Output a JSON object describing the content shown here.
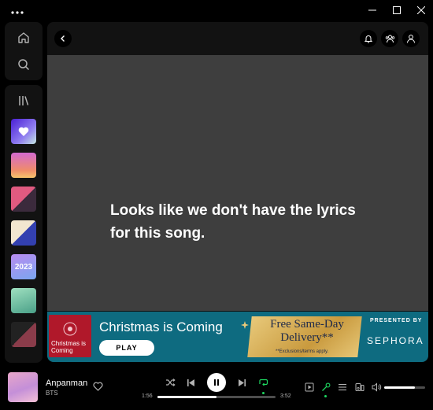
{
  "window": {
    "menu_icon": "more-horizontal-icon",
    "controls": [
      "minimize-icon",
      "maximize-icon",
      "close-icon"
    ]
  },
  "sidebar": {
    "nav": [
      "home-icon",
      "search-icon"
    ],
    "library_icon": "library-icon",
    "playlists": [
      {
        "name": "liked-songs",
        "color": "#6d3cf2"
      },
      {
        "name": "playlist-pink",
        "color": "#e8709c"
      },
      {
        "name": "playlist-collage-1",
        "color": "#b05a7a"
      },
      {
        "name": "playlist-collage-2",
        "color": "#2b3c8f"
      },
      {
        "name": "playlist-2023",
        "color": "#8a6ad6",
        "label": "2023"
      },
      {
        "name": "playlist-green",
        "color": "#6fc39a"
      },
      {
        "name": "playlist-collage-3",
        "color": "#5a4044"
      }
    ]
  },
  "header": {
    "back_icon": "chevron-left-icon",
    "actions": [
      "bell-icon",
      "friends-icon",
      "user-icon"
    ]
  },
  "lyrics": {
    "message": "Looks like we don't have the lyrics for this song."
  },
  "ad": {
    "thumb_text": "Christmas is Coming",
    "title": "Christmas is Coming",
    "play_label": "PLAY",
    "offer": "Free Same-Day Delivery**",
    "fine_print": "**Exclusions/terms apply.",
    "presented_by": "PRESENTED BY",
    "brand": "SEPHORA",
    "colors": {
      "background": "#0e6b80",
      "thumb": "#b0182a",
      "gold": "#d6b062"
    }
  },
  "player": {
    "track_title": "Anpanman",
    "artist": "BTS",
    "elapsed": "1:56",
    "duration": "3:52",
    "progress": 0.5,
    "volume": 0.75,
    "accent": "#1ed760"
  }
}
